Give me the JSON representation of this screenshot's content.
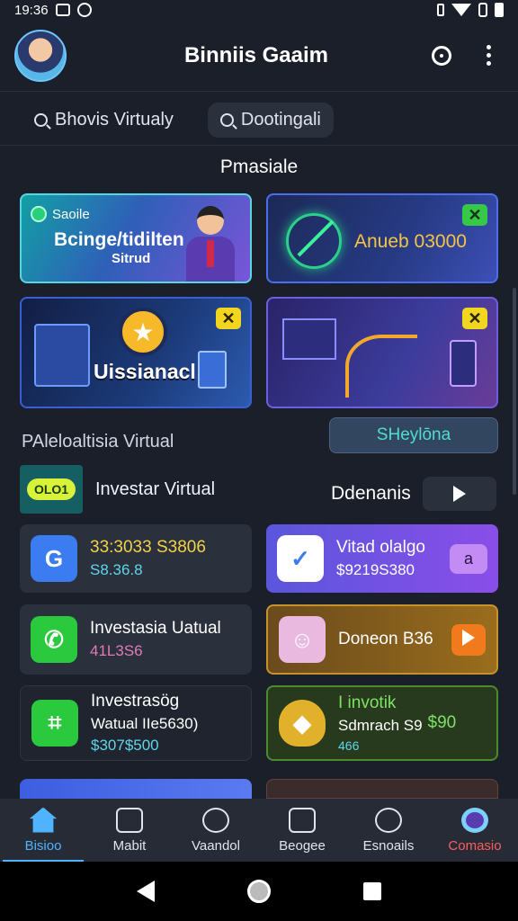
{
  "status": {
    "time": "19:36"
  },
  "app": {
    "title": "Binniis Gaaim"
  },
  "tabs": [
    {
      "label": "Bhovis Virtualy"
    },
    {
      "label": "Dootingali"
    }
  ],
  "section": {
    "title": "Pmasiale"
  },
  "banners": {
    "b1": {
      "tag": "Saoile",
      "title": "Bcinge/tidilten",
      "subtitle": "Sitrud"
    },
    "b2": {
      "text": "Anueb 03000",
      "close": "✕"
    },
    "b3": {
      "title": "Uissianacl",
      "close": "✕"
    },
    "b4": {
      "close": "✕"
    }
  },
  "subheader": "PAleloaltisia Virtual",
  "outline_button": "SHeylōna",
  "list_head": {
    "logo_text": "OLO1",
    "label": "Investar Virtual"
  },
  "donations": {
    "label": "Ddenanis"
  },
  "cards": {
    "l1": {
      "line1": "33:3033 S3806",
      "line2": "S8.36.8"
    },
    "l2": {
      "line1": "Investasia Uatual",
      "line2": "41L3S6"
    },
    "l3": {
      "line1": "Investrasög",
      "line2": "Watual IIe5630)",
      "line3": "$307$500"
    },
    "r1": {
      "line1": "Vitad olalgo",
      "line2": "$9219S380",
      "button": "a"
    },
    "r2": {
      "line1": "Doneon B36"
    },
    "r3": {
      "line1": "I invotik",
      "line2": "Sdmrach S9",
      "line3": "466",
      "value": "$90"
    }
  },
  "bottom_nav": [
    {
      "label": "Bisioo",
      "icon": "home-icon"
    },
    {
      "label": "Mabit",
      "icon": "device-icon"
    },
    {
      "label": "Vaandol",
      "icon": "gauge-icon"
    },
    {
      "label": "Beogee",
      "icon": "checkbox-icon"
    },
    {
      "label": "Esnoails",
      "icon": "notification-icon"
    },
    {
      "label": "Comasio",
      "icon": "profile-icon"
    }
  ],
  "colors": {
    "accent": "#4fb3ff",
    "background": "#1b1f2a"
  }
}
